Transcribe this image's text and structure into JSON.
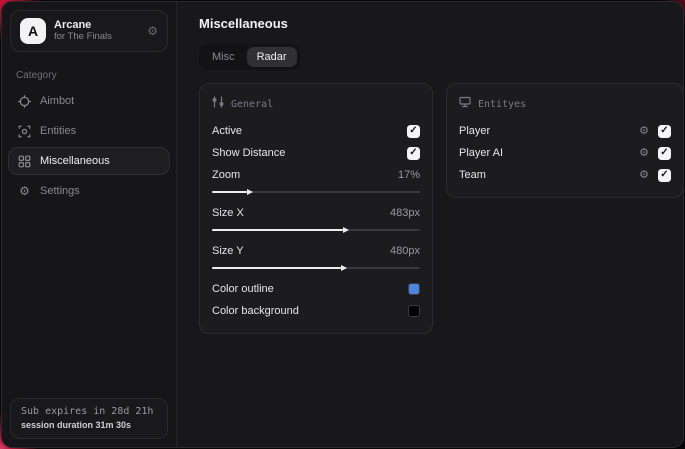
{
  "glyphs": {
    "check": "✓",
    "gear": "⚙"
  },
  "sidebar": {
    "app": {
      "logo_letter": "A",
      "title": "Arcane",
      "subtitle": "for The Finals"
    },
    "category_label": "Category",
    "items": [
      {
        "label": "Aimbot"
      },
      {
        "label": "Entities"
      },
      {
        "label": "Miscellaneous"
      },
      {
        "label": "Settings"
      }
    ],
    "subscription": {
      "expires": "Sub expires in 28d 21h",
      "session": "session duration 31m 30s"
    }
  },
  "main": {
    "title": "Miscellaneous",
    "tabs": [
      {
        "label": "Misc"
      },
      {
        "label": "Radar"
      }
    ],
    "general_panel": {
      "title": "General",
      "toggles": [
        {
          "label": "Active",
          "checked": true
        },
        {
          "label": "Show Distance",
          "checked": true
        }
      ],
      "sliders": [
        {
          "label": "Zoom",
          "value": "17%",
          "percent": 17
        },
        {
          "label": "Size X",
          "value": "483px",
          "percent": 63
        },
        {
          "label": "Size Y",
          "value": "480px",
          "percent": 62
        }
      ],
      "colors": [
        {
          "label": "Color outline",
          "swatch": "#4d84dd"
        },
        {
          "label": "Color background",
          "swatch": "#000000"
        }
      ]
    },
    "entities_panel": {
      "title": "Entityes",
      "rows": [
        {
          "label": "Player",
          "checked": true
        },
        {
          "label": "Player AI",
          "checked": true
        },
        {
          "label": "Team",
          "checked": true
        }
      ]
    }
  }
}
